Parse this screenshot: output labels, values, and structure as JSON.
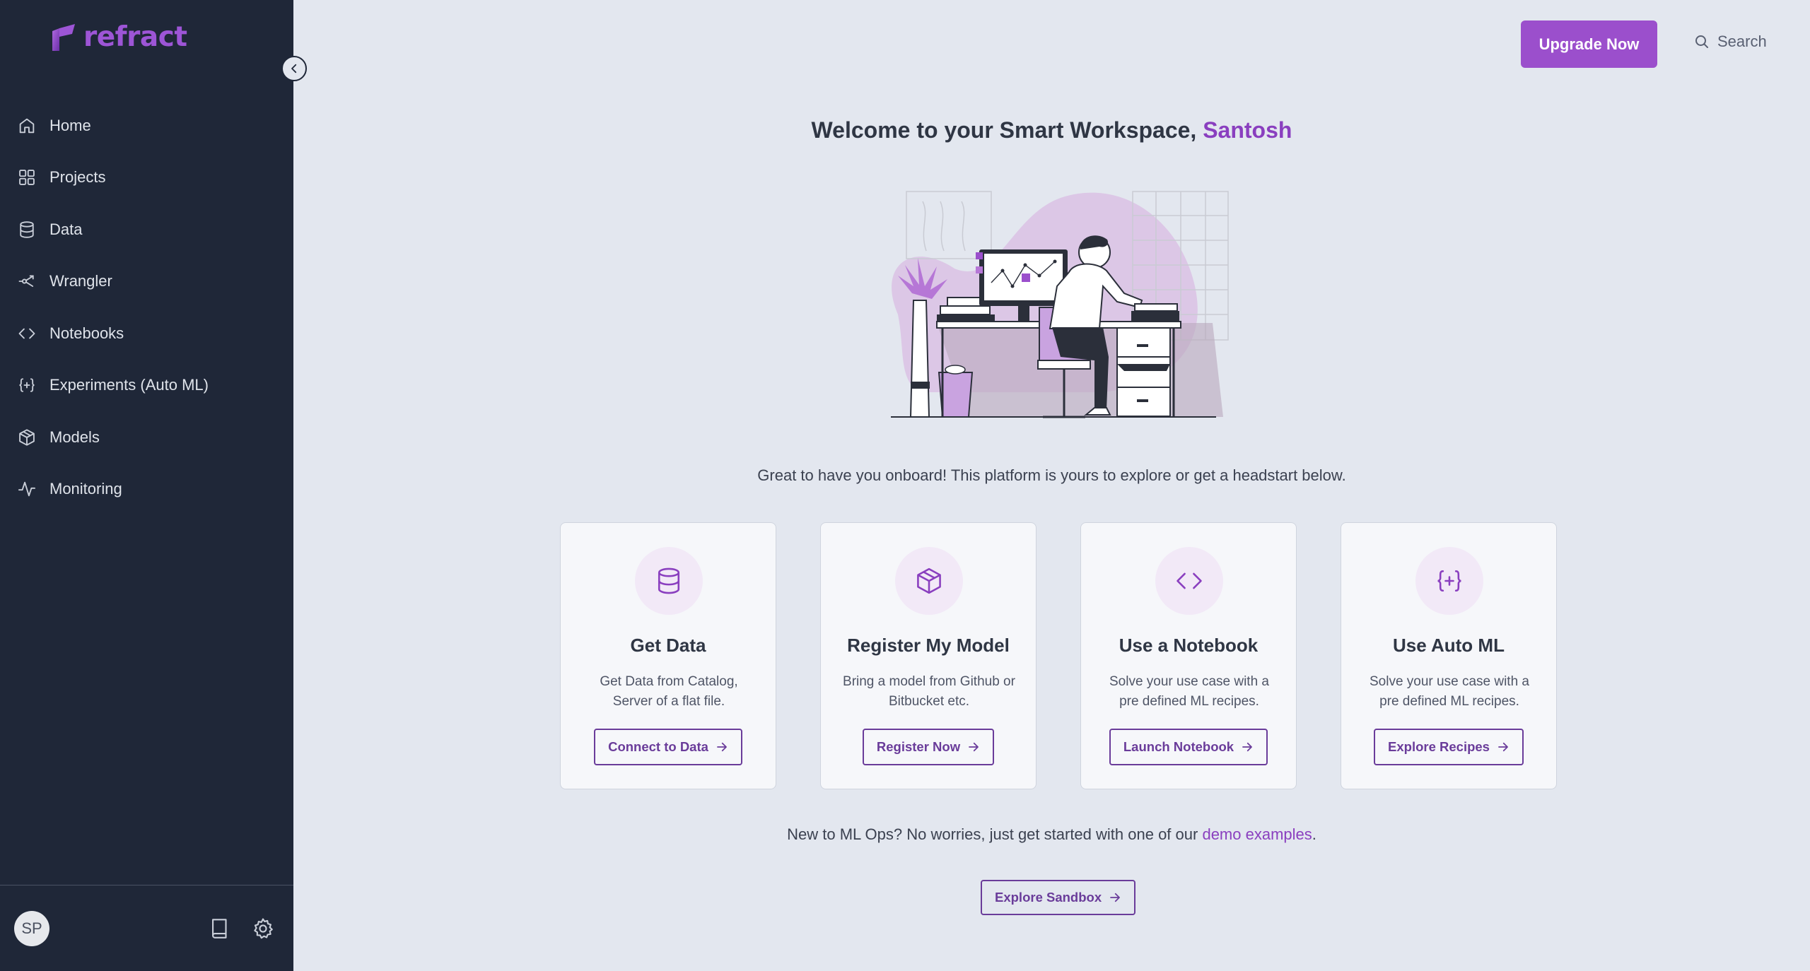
{
  "brand": {
    "name": "refract"
  },
  "colors": {
    "sidebar_bg": "#1f2738",
    "accent": "#9b4fcc",
    "highlight": "#8a3fbf",
    "page_bg": "#e3e7ef"
  },
  "sidebar": {
    "items": [
      {
        "label": "Home",
        "icon": "home-icon"
      },
      {
        "label": "Projects",
        "icon": "grid-icon"
      },
      {
        "label": "Data",
        "icon": "database-icon"
      },
      {
        "label": "Wrangler",
        "icon": "share-icon"
      },
      {
        "label": "Notebooks",
        "icon": "code-icon"
      },
      {
        "label": "Experiments (Auto ML)",
        "icon": "braces-plus-icon"
      },
      {
        "label": "Models",
        "icon": "cube-icon"
      },
      {
        "label": "Monitoring",
        "icon": "pulse-icon"
      }
    ],
    "user_initials": "SP"
  },
  "header": {
    "upgrade_label": "Upgrade Now",
    "search_label": "Search"
  },
  "main": {
    "welcome_prefix": "Welcome to your Smart Workspace, ",
    "user_name": "Santosh",
    "intro": "Great to have you onboard! This platform is yours to explore or get a headstart below.",
    "cards": [
      {
        "title": "Get Data",
        "description": "Get Data from Catalog, Server of a flat file.",
        "button": "Connect to Data",
        "icon": "database-icon"
      },
      {
        "title": "Register My Model",
        "description": "Bring a model from Github or Bitbucket etc.",
        "button": "Register Now",
        "icon": "cube-icon"
      },
      {
        "title": "Use a Notebook",
        "description": "Solve your use case with a pre defined ML recipes.",
        "button": "Launch Notebook",
        "icon": "code-icon"
      },
      {
        "title": "Use Auto ML",
        "description": "Solve your use case with a pre defined ML recipes.",
        "button": "Explore Recipes",
        "icon": "braces-plus-icon"
      }
    ],
    "demo_prefix": "New to ML Ops? No worries, just get started with one of our ",
    "demo_link": "demo examples",
    "demo_suffix": ".",
    "sandbox_button": "Explore Sandbox"
  }
}
